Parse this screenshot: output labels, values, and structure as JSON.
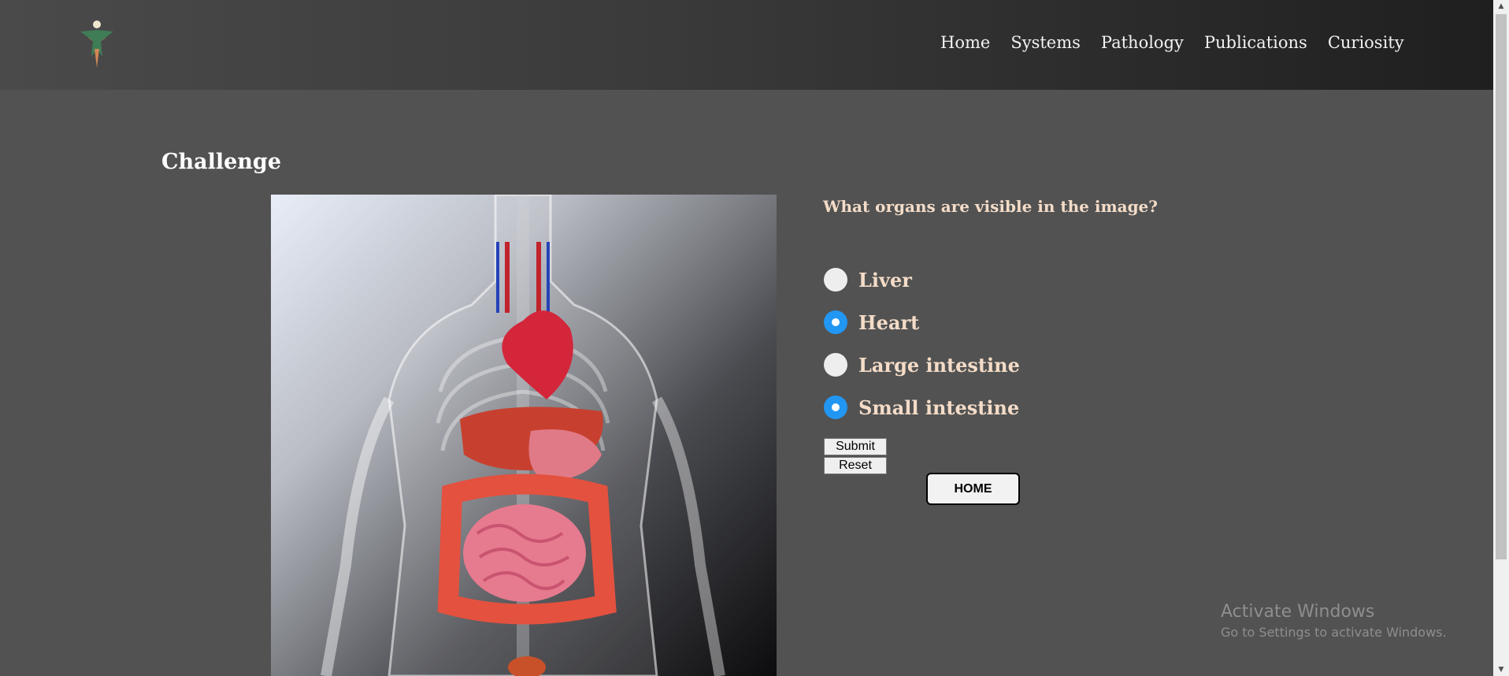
{
  "header": {
    "nav": [
      "Home",
      "Systems",
      "Pathology",
      "Publications",
      "Curiosity"
    ]
  },
  "icons": {
    "logo": "person-figure-logo"
  },
  "page": {
    "title": "Challenge"
  },
  "quiz": {
    "question": "What organs are visible in the image?",
    "options": [
      {
        "label": "Liver",
        "checked": false
      },
      {
        "label": "Heart",
        "checked": true
      },
      {
        "label": "Large intestine",
        "checked": false
      },
      {
        "label": "Small intestine",
        "checked": true
      }
    ],
    "submit_label": "Submit",
    "reset_label": "Reset",
    "home_label": "HOME"
  },
  "watermark": {
    "title": "Activate Windows",
    "subtitle": "Go to Settings to activate Windows."
  },
  "colors": {
    "background": "#525252",
    "accent_text": "#f4dcc8",
    "radio_checked": "#2196f3"
  }
}
